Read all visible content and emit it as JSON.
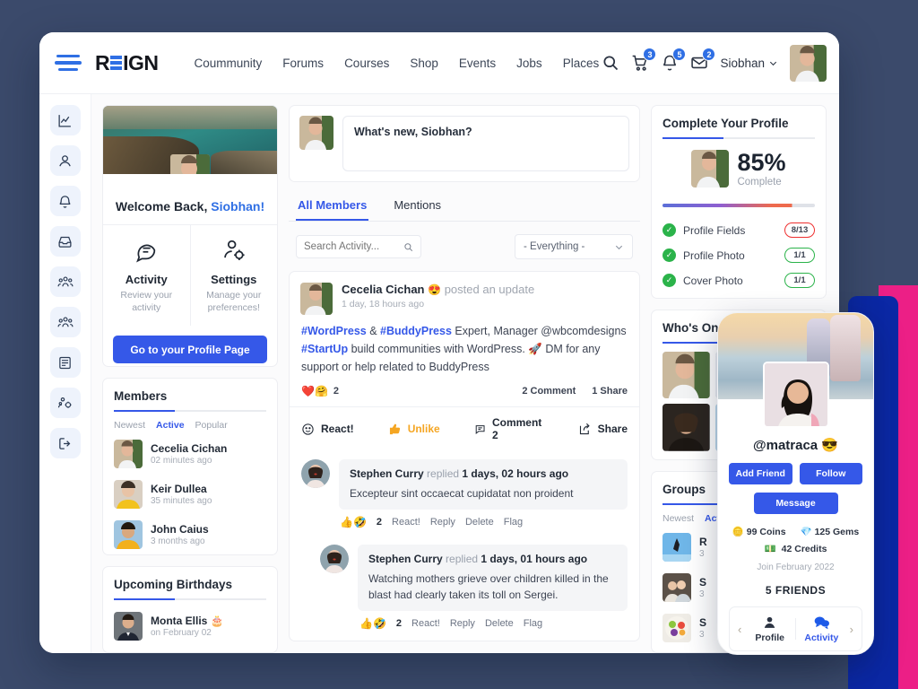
{
  "theme": {
    "accent": "#3558e8",
    "bg": "#3b4a6b",
    "pink": "#ec1f86",
    "deepblue": "#0b28a5",
    "green": "#2bb34a",
    "red": "#ee2f2f",
    "orange": "#f5a623"
  },
  "header": {
    "brand_left": "R",
    "brand_right": "IGN",
    "nav": [
      {
        "label": "Coummunity"
      },
      {
        "label": "Forums"
      },
      {
        "label": "Courses"
      },
      {
        "label": "Shop"
      },
      {
        "label": "Events"
      },
      {
        "label": "Jobs"
      },
      {
        "label": "Places"
      }
    ],
    "icons": [
      {
        "name": "search-icon",
        "badge": ""
      },
      {
        "name": "cart-icon",
        "badge": "3"
      },
      {
        "name": "bell-icon",
        "badge": "5"
      },
      {
        "name": "mail-icon",
        "badge": "2"
      }
    ],
    "user_name": "Siobhan"
  },
  "rail": [
    {
      "name": "activity-chart-icon"
    },
    {
      "name": "profile-icon"
    },
    {
      "name": "notifications-bell-icon"
    },
    {
      "name": "messages-inbox-icon"
    },
    {
      "name": "friends-icon"
    },
    {
      "name": "groups-icon"
    },
    {
      "name": "forums-icon"
    },
    {
      "name": "settings-icon"
    },
    {
      "name": "logout-icon"
    }
  ],
  "welcome": {
    "greeting": "Welcome Back, ",
    "user": "Siobhan!",
    "cells": [
      {
        "title": "Activity",
        "sub": "Review your activity",
        "icon": "chat-bubble-icon"
      },
      {
        "title": "Settings",
        "sub": "Manage your preferences!",
        "icon": "user-gear-icon"
      }
    ],
    "button": "Go to your Profile Page"
  },
  "members_widget": {
    "title": "Members",
    "tabs": [
      {
        "label": "Newest",
        "active": false
      },
      {
        "label": "Active",
        "active": true
      },
      {
        "label": "Popular",
        "active": false
      }
    ],
    "rows": [
      {
        "name": "Cecelia Cichan",
        "time": "02 minutes ago"
      },
      {
        "name": "Keir Dullea",
        "time": "35 minutes ago"
      },
      {
        "name": "John Caius",
        "time": "3 months ago"
      }
    ]
  },
  "birthdays_widget": {
    "title": "Upcoming Birthdays",
    "rows": [
      {
        "name": "Monta Ellis",
        "emoji": "🎂",
        "time": "on February 02"
      }
    ]
  },
  "composer": {
    "placeholder": "What's new, Siobhan?"
  },
  "feed": {
    "tabs": [
      {
        "label": "All Members",
        "active": true
      },
      {
        "label": "Mentions",
        "active": false
      }
    ],
    "search_placeholder": "Search Activity...",
    "filter_value": "- Everything -",
    "post": {
      "author": "Cecelia Cichan",
      "author_emoji": "😍",
      "action": "posted an update",
      "time": "1 day, 18 hours ago",
      "body_parts": [
        {
          "t": "#WordPress",
          "link": true
        },
        {
          "t": " & ",
          "link": false
        },
        {
          "t": "#BuddyPress",
          "link": true
        },
        {
          "t": " Expert, Manager @wbcomdesigns\n",
          "link": false
        },
        {
          "t": "#StartUp",
          "link": true
        },
        {
          "t": " build communities with WordPress. 🚀 DM for any support or help related to BuddyPress",
          "link": false
        }
      ],
      "reaction_emojis": "❤️🤗",
      "reaction_count": "2",
      "comment_count": "2 Comment",
      "share_count": "1 Share",
      "actions": [
        {
          "label": "React!",
          "icon": "smiley-icon",
          "style": "normal"
        },
        {
          "label": "Unlike",
          "icon": "thumbs-up-icon",
          "style": "orange"
        },
        {
          "label": "Comment 2",
          "icon": "comment-icon",
          "style": "normal"
        },
        {
          "label": "Share",
          "icon": "share-icon",
          "style": "normal"
        }
      ]
    },
    "comments": [
      {
        "author": "Stephen Curry",
        "action": "replied",
        "time": "1 days, 02 hours ago",
        "text": "Excepteur sint occaecat cupidatat non proident",
        "emojis": "👍🤣",
        "count": "2",
        "links": [
          "React!",
          "Reply",
          "Delete",
          "Flag"
        ],
        "indent": false
      },
      {
        "author": "Stephen Curry",
        "action": "replied",
        "time": "1 days, 01 hours ago",
        "text": "Watching mothers grieve over children killed in the blast had clearly taken its toll on Sergei.",
        "emojis": "👍🤣",
        "count": "2",
        "links": [
          "React!",
          "Reply",
          "Delete",
          "Flag"
        ],
        "indent": true
      }
    ]
  },
  "profile_widget": {
    "title": "Complete Your Profile",
    "percent": "85%",
    "percent_label": "Complete",
    "items": [
      {
        "label": "Profile Fields",
        "value": "8/13",
        "warn": true
      },
      {
        "label": "Profile Photo",
        "value": "1/1",
        "warn": false
      },
      {
        "label": "Cover Photo",
        "value": "1/1",
        "warn": false
      }
    ]
  },
  "online_widget": {
    "title": "Who's Online"
  },
  "groups_widget": {
    "title": "Groups",
    "tabs": [
      {
        "label": "Newest"
      },
      {
        "label": "Active"
      }
    ],
    "rows": [
      {
        "initial": "R",
        "time": "3"
      },
      {
        "initial": "S",
        "time": "3"
      },
      {
        "initial": "S",
        "time": "3"
      }
    ]
  },
  "phone": {
    "handle": "@matraca",
    "handle_emoji": "😎",
    "buttons": [
      {
        "label": "Add Friend"
      },
      {
        "label": "Follow"
      }
    ],
    "message_button": "Message",
    "stats": [
      {
        "icon": "coin-icon",
        "glyph": "🪙",
        "label": "99 Coins"
      },
      {
        "icon": "gem-icon",
        "glyph": "💎",
        "label": "125 Gems"
      }
    ],
    "credits": {
      "icon": "money-icon",
      "glyph": "💵",
      "label": "42 Credits"
    },
    "join": "Join February 2022",
    "friends": "5 FRIENDS",
    "nav": [
      {
        "label": "Profile",
        "icon": "person-icon",
        "active": false
      },
      {
        "label": "Activity",
        "icon": "chat-icon",
        "active": true
      }
    ]
  }
}
